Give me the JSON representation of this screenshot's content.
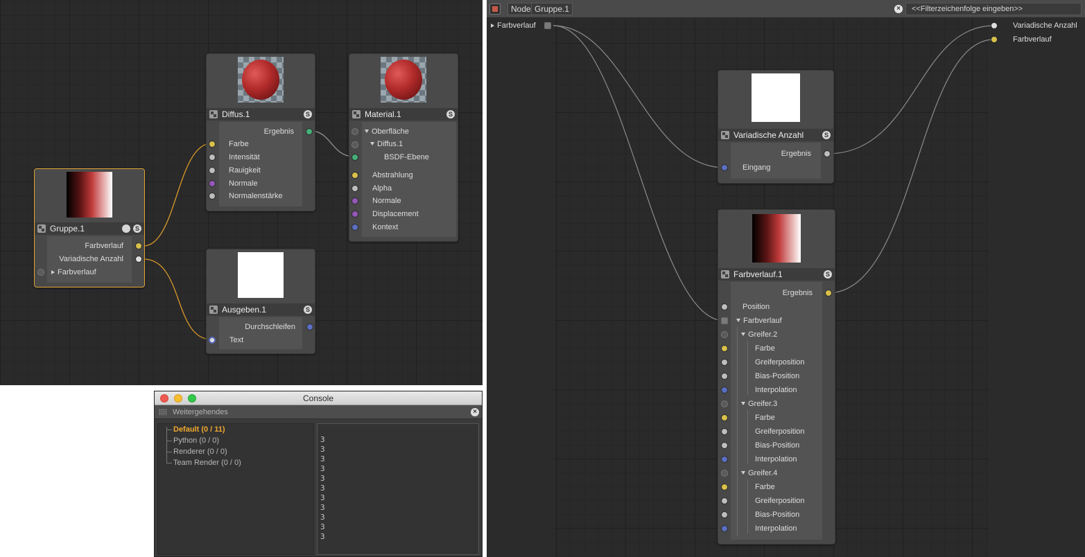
{
  "left_editor": {
    "nodes": {
      "diffus": {
        "title": "Diffus.1",
        "badge": "S",
        "output": "Ergebnis",
        "inputs": [
          "Farbe",
          "Intensität",
          "Rauigkeit",
          "Normale",
          "Normalenstärke"
        ]
      },
      "material": {
        "title": "Material.1",
        "badge": "S",
        "tree": [
          "Oberfläche",
          "Diffus.1",
          "BSDF-Ebene"
        ],
        "inputs": [
          "Abstrahlung",
          "Alpha",
          "Normale",
          "Displacement",
          "Kontext"
        ]
      },
      "gruppe": {
        "title": "Gruppe.1",
        "badge": "S",
        "outputs": [
          "Farbverlauf",
          "Variadische Anzahl"
        ],
        "input": "Farbverlauf"
      },
      "ausgeben": {
        "title": "Ausgeben.1",
        "badge": "S",
        "output": "Durchschleifen",
        "input": "Text"
      }
    }
  },
  "console": {
    "title": "Console",
    "subbar": "Weitergehendes",
    "close": "×",
    "channels": [
      "Default (0 / 11)",
      "Python (0 / 0)",
      "Renderer (0 / 0)",
      "Team Render  (0 / 0)"
    ],
    "output_lines": [
      "3",
      "3",
      "3",
      "3",
      "3",
      "3",
      "3",
      "3",
      "3",
      "3",
      "3"
    ]
  },
  "right_editor": {
    "breadcrumb": [
      "Node",
      "Gruppe.1"
    ],
    "filter_placeholder": "<<Filterzeichenfolge eingeben>>",
    "filter_close": "×",
    "group_input": "Farbverlauf",
    "group_outputs": [
      "Variadische Anzahl",
      "Farbverlauf"
    ],
    "variadic": {
      "title": "Variadische Anzahl",
      "badge": "S",
      "output": "Ergebnis",
      "input": "Eingang"
    },
    "farbverlauf": {
      "title": "Farbverlauf.1",
      "badge": "S",
      "output": "Ergebnis",
      "position": "Position",
      "gradient": "Farbverlauf",
      "knots": [
        {
          "name": "Greifer.2",
          "fields": [
            "Farbe",
            "Greiferposition",
            "Bias-Position",
            "Interpolation"
          ]
        },
        {
          "name": "Greifer.3",
          "fields": [
            "Farbe",
            "Greiferposition",
            "Bias-Position",
            "Interpolation"
          ]
        },
        {
          "name": "Greifer.4",
          "fields": [
            "Farbe",
            "Greiferposition",
            "Bias-Position",
            "Interpolation"
          ]
        }
      ]
    }
  },
  "colors": {
    "selected_border": "#e3a834",
    "wire_orange": "#d89a2a",
    "wire_grey": "#8c8c8c",
    "active_channel": "#f0a830"
  }
}
